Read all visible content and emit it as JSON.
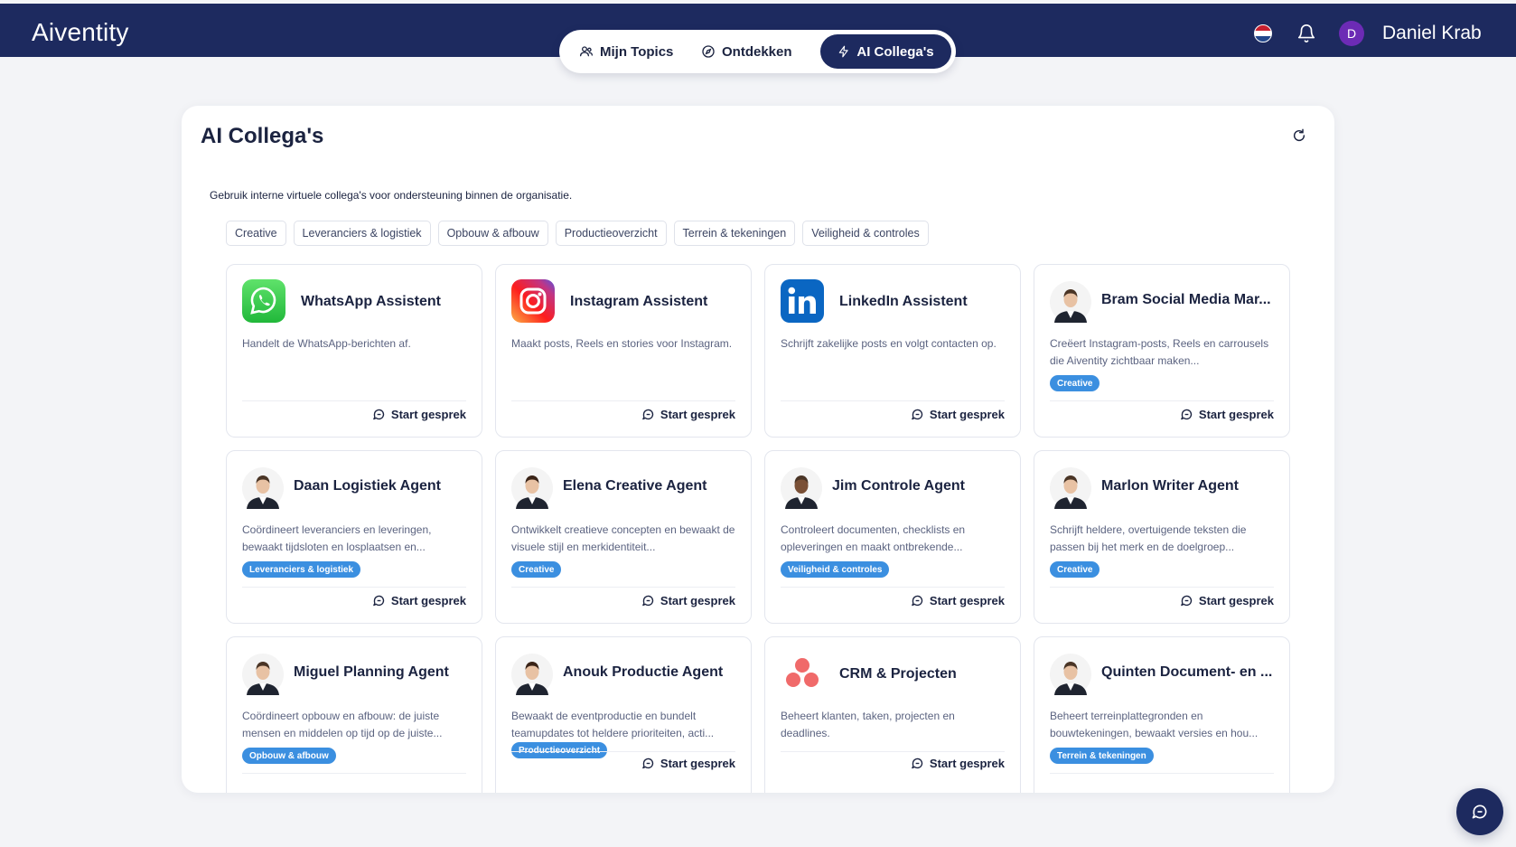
{
  "app": {
    "logo": "Aiventity"
  },
  "nav": {
    "tabs": [
      {
        "label": "Mijn Topics",
        "icon": "users-icon"
      },
      {
        "label": "Ontdekken",
        "icon": "compass-icon"
      },
      {
        "label": "AI Collega's",
        "icon": "bolt-icon",
        "active": true
      }
    ]
  },
  "header": {
    "user_initial": "D",
    "user_name": "Daniel Krab"
  },
  "panel": {
    "title": "AI Collega's",
    "subtitle": "Gebruik interne virtuele collega's voor ondersteuning binnen de organisatie."
  },
  "filters": [
    "Creative",
    "Leveranciers & logistiek",
    "Opbouw & afbouw",
    "Productieoverzicht",
    "Terrein & tekeningen",
    "Veiligheid & controles"
  ],
  "start_label": "Start gesprek",
  "agents": [
    {
      "name": "WhatsApp Assistent",
      "desc": "Handelt de WhatsApp-berichten af.",
      "tag": "",
      "icon": "whatsapp-icon"
    },
    {
      "name": "Instagram Assistent",
      "desc": "Maakt posts, Reels en stories voor Instagram.",
      "tag": "",
      "icon": "instagram-icon"
    },
    {
      "name": "LinkedIn Assistent",
      "desc": "Schrijft zakelijke posts en volgt contacten op.",
      "tag": "",
      "icon": "linkedin-icon"
    },
    {
      "name": "Bram Social Media Mar...",
      "desc": "Creëert Instagram-posts, Reels en carrousels die Aiventity zichtbaar maken...",
      "tag": "Creative",
      "icon": "person-avatar"
    },
    {
      "name": "Daan Logistiek Agent",
      "desc": "Coördineert leveranciers en leveringen, bewaakt tijdsloten en losplaatsen en...",
      "tag": "Leveranciers & logistiek",
      "icon": "person-avatar"
    },
    {
      "name": "Elena Creative Agent",
      "desc": "Ontwikkelt creatieve concepten en bewaakt de visuele stijl en merkidentiteit...",
      "tag": "Creative",
      "icon": "person-avatar"
    },
    {
      "name": "Jim Controle Agent",
      "desc": "Controleert documenten, checklists en opleveringen en maakt ontbrekende...",
      "tag": "Veiligheid & controles",
      "icon": "person-avatar"
    },
    {
      "name": "Marlon Writer Agent",
      "desc": "Schrijft heldere, overtuigende teksten die passen bij het merk en de doelgroep...",
      "tag": "Creative",
      "icon": "person-avatar"
    },
    {
      "name": "Miguel Planning Agent",
      "desc": "Coördineert opbouw en afbouw: de juiste mensen en middelen op tijd op de juiste...",
      "tag": "Opbouw & afbouw",
      "icon": "person-avatar"
    },
    {
      "name": "Anouk Productie Agent",
      "desc": "Bewaakt de eventproductie en bundelt teamupdates tot heldere prioriteiten, acti...",
      "tag": "Productieoverzicht",
      "icon": "person-avatar"
    },
    {
      "name": "CRM & Projecten",
      "desc": "Beheert klanten, taken, projecten en deadlines.",
      "tag": "",
      "icon": "asana-icon"
    },
    {
      "name": "Quinten Document- en ...",
      "desc": "Beheert terreinplattegronden en bouwtekeningen, bewaakt versies en hou...",
      "tag": "Terrein & tekeningen",
      "icon": "person-avatar"
    }
  ],
  "colors": {
    "navy": "#1d2a5f",
    "tag_blue": "#3b8fe0"
  }
}
